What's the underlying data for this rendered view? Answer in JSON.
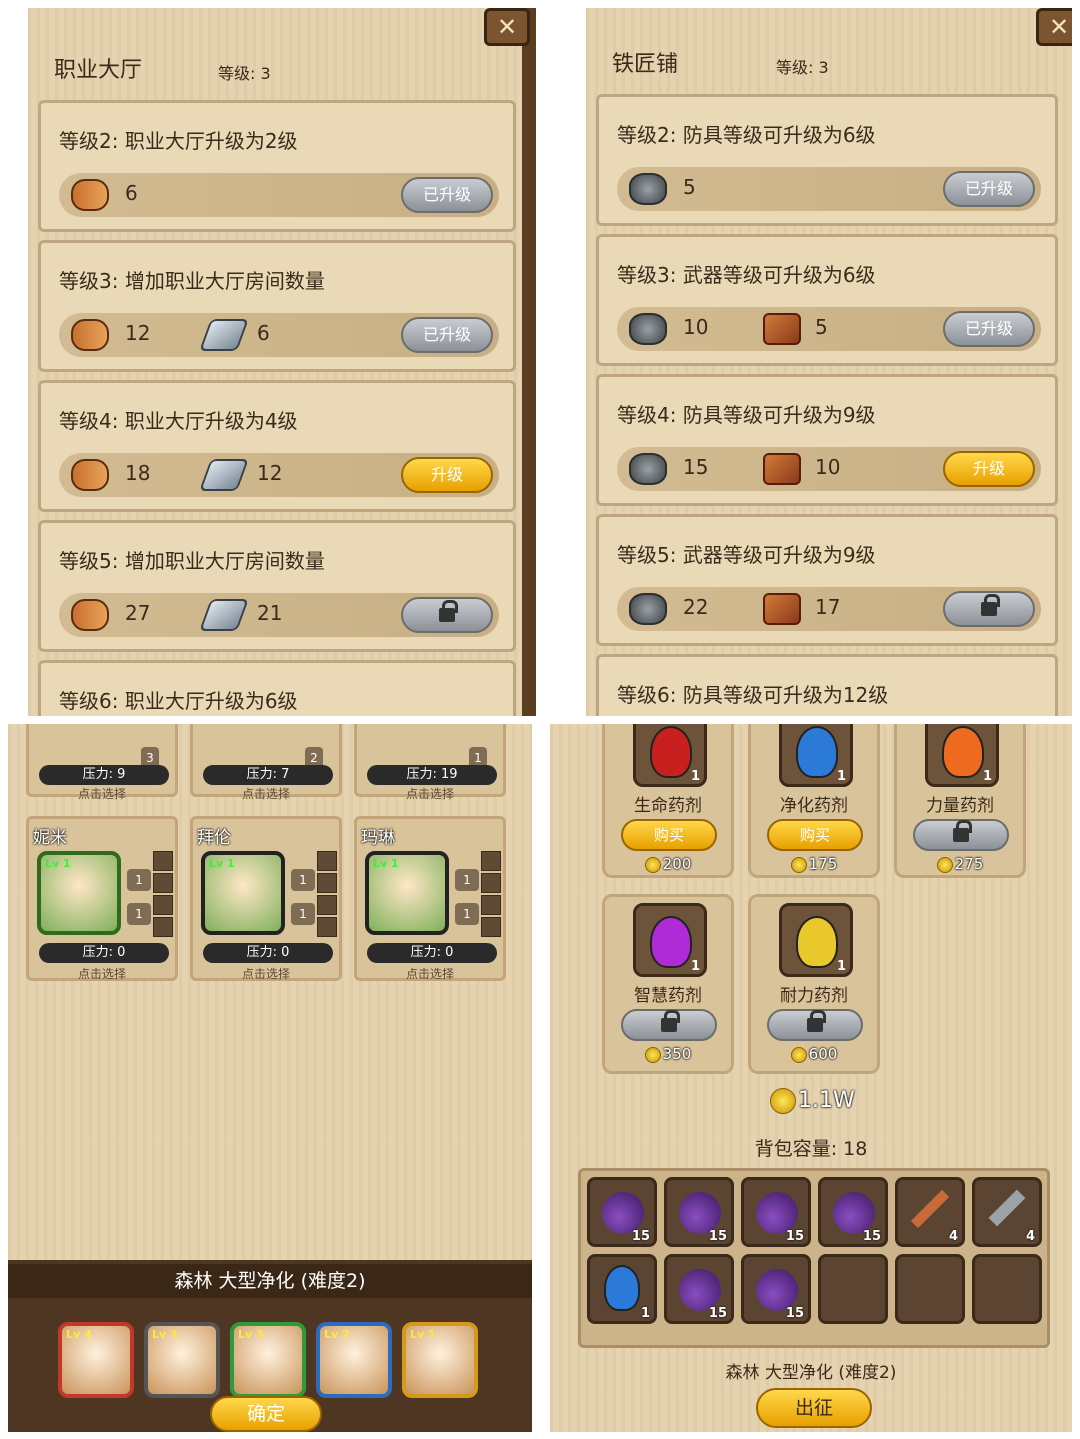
{
  "q1": {
    "title": "职业大厅",
    "level": "等级: 3",
    "cards": [
      {
        "text": "等级2: 职业大厅升级为2级",
        "res1": "6",
        "res2": "",
        "btn": "已升级",
        "state": "upgraded"
      },
      {
        "text": "等级3: 增加职业大厅房间数量",
        "res1": "12",
        "res2": "6",
        "btn": "已升级",
        "state": "upgraded"
      },
      {
        "text": "等级4: 职业大厅升级为4级",
        "res1": "18",
        "res2": "12",
        "btn": "升级",
        "state": "available"
      },
      {
        "text": "等级5: 增加职业大厅房间数量",
        "res1": "27",
        "res2": "21",
        "btn": "",
        "state": "locked"
      },
      {
        "text": "等级6: 职业大厅升级为6级",
        "res1": "",
        "res2": "",
        "btn": "",
        "state": "partial"
      }
    ]
  },
  "q2": {
    "title": "铁匠铺",
    "level": "等级: 3",
    "cards": [
      {
        "text": "等级2: 防具等级可升级为6级",
        "res1": "5",
        "res2": "",
        "btn": "已升级",
        "state": "upgraded"
      },
      {
        "text": "等级3: 武器等级可升级为6级",
        "res1": "10",
        "res2": "5",
        "btn": "已升级",
        "state": "upgraded"
      },
      {
        "text": "等级4: 防具等级可升级为9级",
        "res1": "15",
        "res2": "10",
        "btn": "升级",
        "state": "available"
      },
      {
        "text": "等级5: 武器等级可升级为9级",
        "res1": "22",
        "res2": "17",
        "btn": "",
        "state": "locked"
      },
      {
        "text": "等级6: 防具等级可升级为12级",
        "res1": "",
        "res2": "",
        "btn": "",
        "state": "partial"
      }
    ]
  },
  "q3": {
    "top_row": [
      {
        "count": "3",
        "pressure": "压力: 9",
        "tap": "点击选择"
      },
      {
        "count": "2",
        "pressure": "压力: 7",
        "tap": "点击选择"
      },
      {
        "count": "1",
        "pressure": "压力: 19",
        "tap": "点击选择"
      }
    ],
    "heroes": [
      {
        "name": "妮米",
        "lv": "Lv 1",
        "g1": "1",
        "g2": "1",
        "pressure": "压力: 0",
        "tap": "点击选择"
      },
      {
        "name": "拜伦",
        "lv": "Lv 1",
        "g1": "1",
        "g2": "1",
        "pressure": "压力: 0",
        "tap": "点击选择"
      },
      {
        "name": "玛琳",
        "lv": "Lv 1",
        "g1": "1",
        "g2": "1",
        "pressure": "压力: 0",
        "tap": "点击选择"
      }
    ],
    "mission": "森林 大型净化 (难度2)",
    "party": [
      {
        "lv": "Lv 4",
        "color": "#c0392b"
      },
      {
        "lv": "Lv 3",
        "color": "#555555"
      },
      {
        "lv": "Lv 3",
        "color": "#2e9b3c"
      },
      {
        "lv": "Lv 2",
        "color": "#2b6cc0"
      },
      {
        "lv": "Lv 1",
        "color": "#d49b1a"
      }
    ],
    "confirm": "确定"
  },
  "q4": {
    "potions": [
      {
        "name": "生命药剂",
        "qty": "1",
        "btn": "购买",
        "price": "200",
        "color": "#c8201e",
        "state": "buy"
      },
      {
        "name": "净化药剂",
        "qty": "1",
        "btn": "购买",
        "price": "175",
        "color": "#2c7ad8",
        "state": "buy"
      },
      {
        "name": "力量药剂",
        "qty": "1",
        "btn": "",
        "price": "275",
        "color": "#ee6a1e",
        "state": "locked"
      },
      {
        "name": "智慧药剂",
        "qty": "1",
        "btn": "",
        "price": "350",
        "color": "#b02ad8",
        "state": "locked"
      },
      {
        "name": "耐力药剂",
        "qty": "1",
        "btn": "",
        "price": "600",
        "color": "#e8c82a",
        "state": "locked"
      }
    ],
    "gold": "1.1W",
    "capacity": "背包容量: 18",
    "inventory": [
      {
        "item": "grape-food",
        "qty": "15"
      },
      {
        "item": "grape-food",
        "qty": "15"
      },
      {
        "item": "grape-food",
        "qty": "15"
      },
      {
        "item": "grape-food",
        "qty": "15"
      },
      {
        "item": "key",
        "qty": "4"
      },
      {
        "item": "shovel",
        "qty": "4"
      },
      {
        "item": "blue-potion",
        "qty": "1"
      },
      {
        "item": "grape-food",
        "qty": "15"
      },
      {
        "item": "grape-food",
        "qty": "15"
      },
      {
        "item": "empty",
        "qty": ""
      },
      {
        "item": "empty",
        "qty": ""
      },
      {
        "item": "empty",
        "qty": ""
      }
    ],
    "mission": "森林 大型净化 (难度2)",
    "go": "出征"
  }
}
